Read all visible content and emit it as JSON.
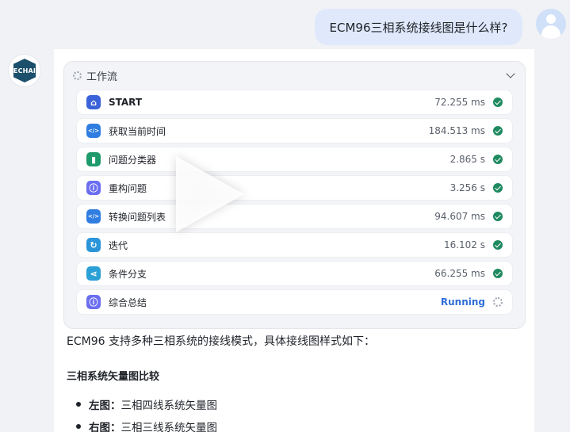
{
  "user": {
    "message": "ECM96三相系统接线图是什么样?"
  },
  "bot": {
    "avatar_text": "ECHAI"
  },
  "workflow": {
    "title": "工作流",
    "nodes": [
      {
        "label": "START",
        "time": "72.255 ms",
        "status": "done",
        "icon": "home-icon",
        "color": "#3b63d9"
      },
      {
        "label": "获取当前时间",
        "time": "184.513 ms",
        "status": "done",
        "icon": "code-icon",
        "color": "#2f7de0"
      },
      {
        "label": "问题分类器",
        "time": "2.865 s",
        "status": "done",
        "icon": "classifier-icon",
        "color": "#1f9a6a"
      },
      {
        "label": "重构问题",
        "time": "3.256 s",
        "status": "done",
        "icon": "llm-icon",
        "color": "#6b6ef0"
      },
      {
        "label": "转换问题列表",
        "time": "94.607 ms",
        "status": "done",
        "icon": "code-icon",
        "color": "#2f7de0"
      },
      {
        "label": "迭代",
        "time": "16.102 s",
        "status": "done",
        "icon": "loop-icon",
        "color": "#2a95d8"
      },
      {
        "label": "条件分支",
        "time": "66.255 ms",
        "status": "done",
        "icon": "branch-icon",
        "color": "#2aa0d6"
      },
      {
        "label": "综合总结",
        "time": "Running",
        "status": "running",
        "icon": "llm-icon",
        "color": "#6b6ef0"
      }
    ]
  },
  "answer": {
    "intro": "ECM96 支持多种三相系统的接线模式，具体接线图样式如下：",
    "heading": "三相系统矢量图比较",
    "items": [
      {
        "key": "左图：",
        "text": "三相四线系统矢量图"
      },
      {
        "key": "右图：",
        "text": "三相三线系统矢量图"
      }
    ]
  }
}
